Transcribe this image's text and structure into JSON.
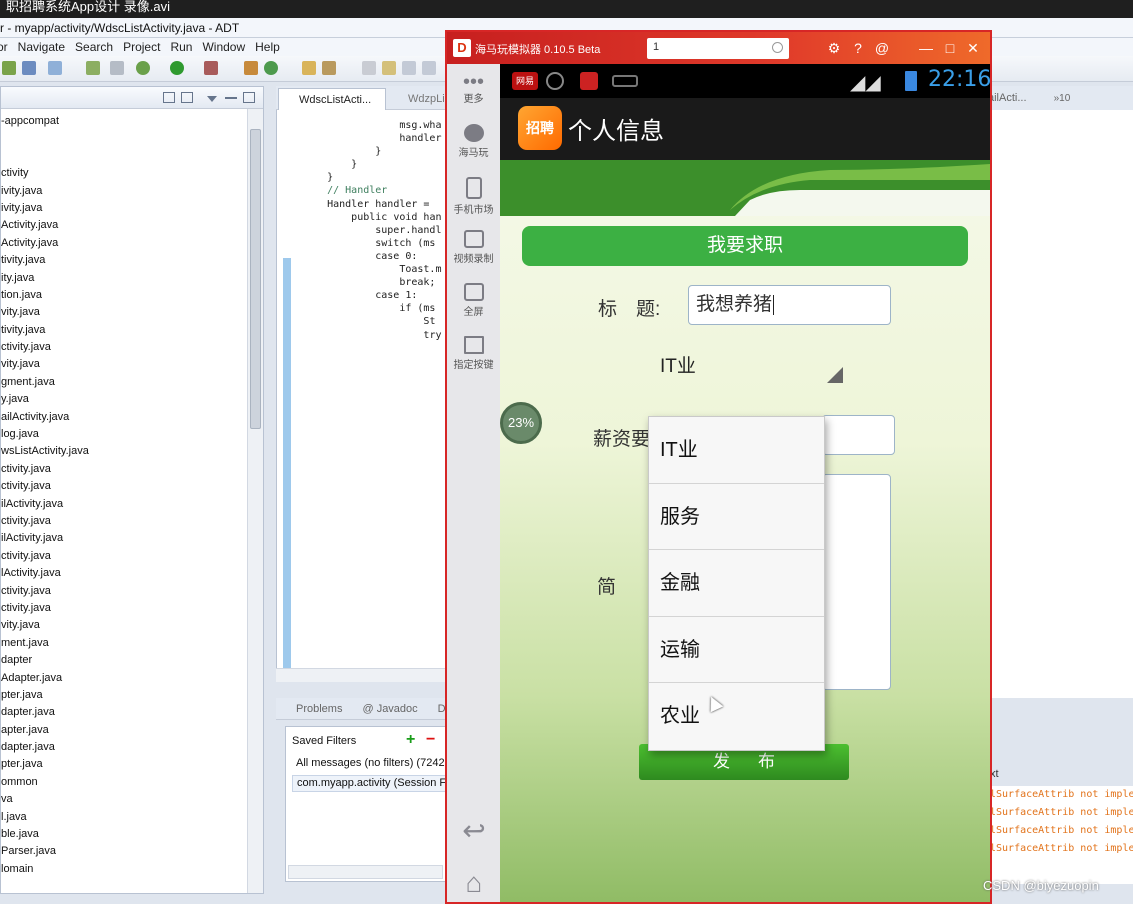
{
  "recorder": {
    "title": "职招聘系统App设计 录像.avi"
  },
  "eclipse": {
    "title": "r - myapp/activity/WdscListActivity.java - ADT",
    "menu": [
      "or",
      "Navigate",
      "Search",
      "Project",
      "Run",
      "Window",
      "Help"
    ],
    "package_tree": [
      "-appcompat",
      "",
      "",
      "ctivity",
      "ivity.java",
      "ivity.java",
      "Activity.java",
      "Activity.java",
      "tivity.java",
      "ity.java",
      "tion.java",
      "vity.java",
      "tivity.java",
      "ctivity.java",
      "vity.java",
      "gment.java",
      "y.java",
      "ailActivity.java",
      "log.java",
      "wsListActivity.java",
      "ctivity.java",
      "ctivity.java",
      "ilActivity.java",
      "ctivity.java",
      "ilActivity.java",
      "ctivity.java",
      "lActivity.java",
      "ctivity.java",
      "ctivity.java",
      "vity.java",
      "ment.java",
      "dapter",
      "Adapter.java",
      "pter.java",
      "dapter.java",
      "apter.java",
      "dapter.java",
      "pter.java",
      "ommon",
      "va",
      "l.java",
      "ble.java",
      "Parser.java",
      "lomain"
    ],
    "editor_tabs": [
      "WdscListActi...",
      "WdzpLis"
    ],
    "code_lines": [
      {
        "indent": "                ",
        "text": "msg.wha"
      },
      {
        "indent": "",
        "text": ""
      },
      {
        "indent": "                ",
        "text": "handler"
      },
      {
        "indent": "",
        "text": ""
      },
      {
        "indent": "            ",
        "text": "}"
      },
      {
        "indent": "        ",
        "text": "}"
      },
      {
        "indent": "    ",
        "text": "}"
      },
      {
        "indent": "",
        "text": ""
      },
      {
        "indent": "    ",
        "text": "// Handler"
      },
      {
        "indent": "    ",
        "text": "Handler handler = "
      },
      {
        "indent": "        ",
        "text": "public void han"
      },
      {
        "indent": "",
        "text": ""
      },
      {
        "indent": "            ",
        "text": "super.handl"
      },
      {
        "indent": "",
        "text": ""
      },
      {
        "indent": "            ",
        "text": "switch (ms"
      },
      {
        "indent": "",
        "text": ""
      },
      {
        "indent": "            ",
        "text": "case 0:"
      },
      {
        "indent": "",
        "text": ""
      },
      {
        "indent": "                ",
        "text": "Toast.m"
      },
      {
        "indent": "",
        "text": ""
      },
      {
        "indent": "                ",
        "text": "break;"
      },
      {
        "indent": "",
        "text": ""
      },
      {
        "indent": "            ",
        "text": "case 1:"
      },
      {
        "indent": "",
        "text": ""
      },
      {
        "indent": "                ",
        "text": "if (ms"
      },
      {
        "indent": "                    ",
        "text": "St"
      },
      {
        "indent": "",
        "text": ""
      },
      {
        "indent": "                    ",
        "text": "try"
      }
    ],
    "bottom_tabs": [
      "Problems",
      "@ Javadoc",
      "Dec"
    ],
    "saved_filters": {
      "title": "Saved Filters",
      "rows": [
        "All messages (no filters) (7242",
        "com.myapp.activity (Session F"
      ]
    },
    "right_fragments": {
      "tab": "ailActi...",
      "overflow": "»10",
      "header": "xt"
    },
    "log_lines": [
      "lSurfaceAttrib not imple",
      "lSurfaceAttrib not imple",
      "lSurfaceAttrib not imple",
      "lSurfaceAttrib not imple"
    ]
  },
  "emulator": {
    "title": "海马玩模拟器 0.10.5 Beta",
    "search_value": "1",
    "sidebar": [
      {
        "icon": "more-icon",
        "label": "更多"
      },
      {
        "icon": "haimawan-icon",
        "label": "海马玩"
      },
      {
        "icon": "market-icon",
        "label": "手机市场"
      },
      {
        "icon": "video-record-icon",
        "label": "视频录制"
      },
      {
        "icon": "fullscreen-icon",
        "label": "全屏"
      },
      {
        "icon": "keymap-icon",
        "label": "指定按键"
      }
    ],
    "status_bar": {
      "app1": "网易",
      "time": "22:16"
    },
    "app": {
      "icon_text": "招聘",
      "title": "个人信息",
      "post_job_button": "我要求职",
      "title_label": "标　题:",
      "title_value": "我想养猪",
      "industry_selected": "IT业",
      "salary_label": "薪资要",
      "intro_label": "简",
      "publish_button": "发布",
      "progress": "23%",
      "industry_options": [
        "IT业",
        "服务",
        "金融",
        "运输",
        "农业"
      ]
    }
  },
  "watermark": "CSDN @biyezuopin",
  "colors": {
    "emulator_red": "#d72626",
    "accent_green": "#3cb043",
    "time_blue": "#3a9fe8"
  }
}
